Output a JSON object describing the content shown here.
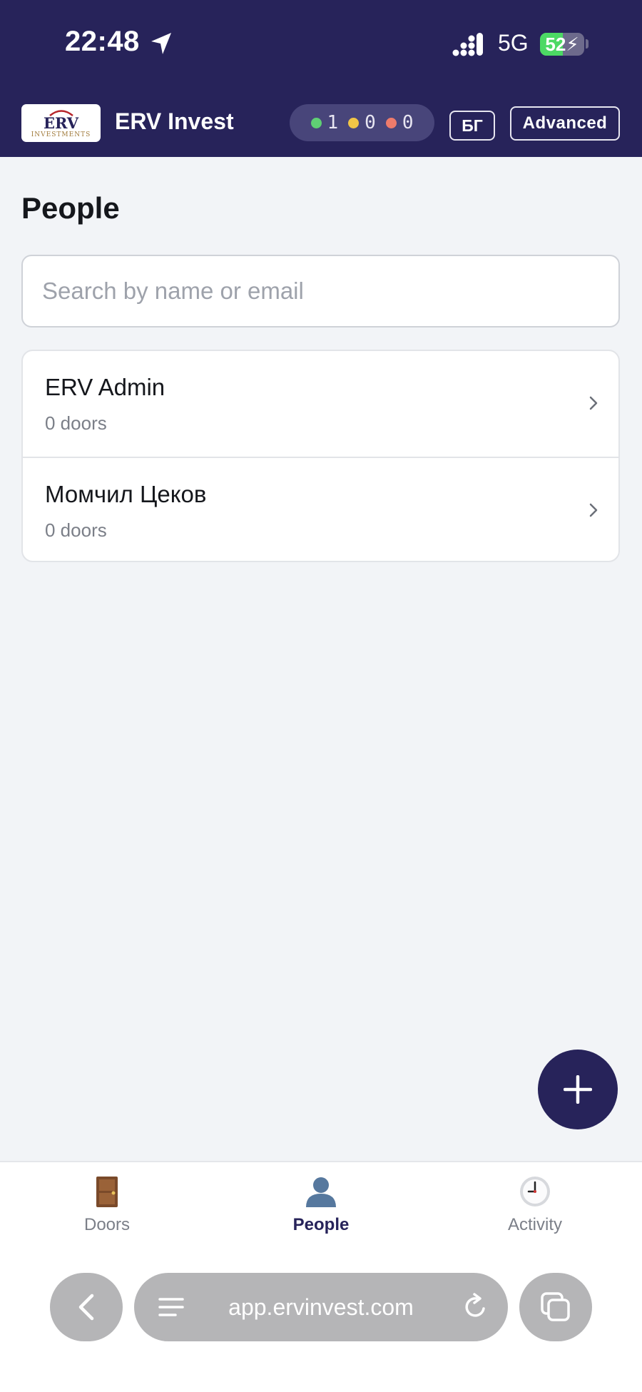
{
  "status_bar": {
    "time": "22:48",
    "network": "5G",
    "battery": "52",
    "battery_level": 0.52
  },
  "header": {
    "logo_main": "ERV",
    "logo_sub": "INVESTMENTS",
    "app_title": "ERV Invest",
    "counters": [
      {
        "value": "1",
        "color": "#5fcf74"
      },
      {
        "value": "0",
        "color": "#f1c546"
      },
      {
        "value": "0",
        "color": "#ee7b6b"
      }
    ],
    "lang_label": "БГ",
    "advanced_label": "Advanced"
  },
  "main": {
    "title": "People",
    "search": {
      "placeholder": "Search by name or email",
      "value": ""
    },
    "people": [
      {
        "name": "ERV Admin",
        "doors": "0 doors"
      },
      {
        "name": "Момчил Цеков",
        "doors": "0 doors"
      }
    ]
  },
  "bottom_nav": {
    "tabs": [
      {
        "label": "Doors",
        "icon": "door-icon"
      },
      {
        "label": "People",
        "icon": "person-icon",
        "active": true
      },
      {
        "label": "Activity",
        "icon": "clock-icon"
      }
    ]
  },
  "browser": {
    "url": "app.ervinvest.com"
  },
  "colors": {
    "brand": "#27235a",
    "background": "#f2f4f7"
  }
}
